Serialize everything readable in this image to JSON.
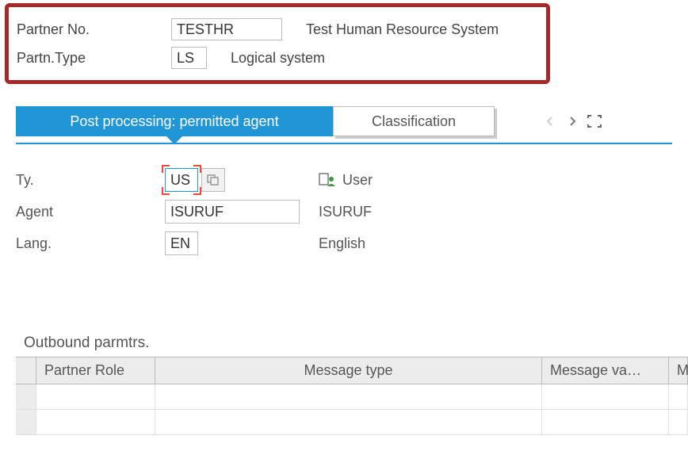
{
  "header": {
    "partner_no_label": "Partner No.",
    "partner_no_value": "TESTHR",
    "partner_no_desc": "Test Human Resource System",
    "partn_type_label": "Partn.Type",
    "partn_type_value": "LS",
    "partn_type_desc": "Logical system"
  },
  "tabs": {
    "active": "Post processing: permitted agent",
    "inactive": "Classification"
  },
  "form": {
    "ty_label": "Ty.",
    "ty_value": "US",
    "ty_desc": "User",
    "agent_label": "Agent",
    "agent_value": "ISURUF",
    "agent_desc": "ISURUF",
    "lang_label": "Lang.",
    "lang_value": "EN",
    "lang_desc": "English"
  },
  "table": {
    "section_title": "Outbound parmtrs.",
    "columns": {
      "partner_role": "Partner Role",
      "message_type": "Message type",
      "message_va": "Message va…",
      "m": "M"
    }
  }
}
